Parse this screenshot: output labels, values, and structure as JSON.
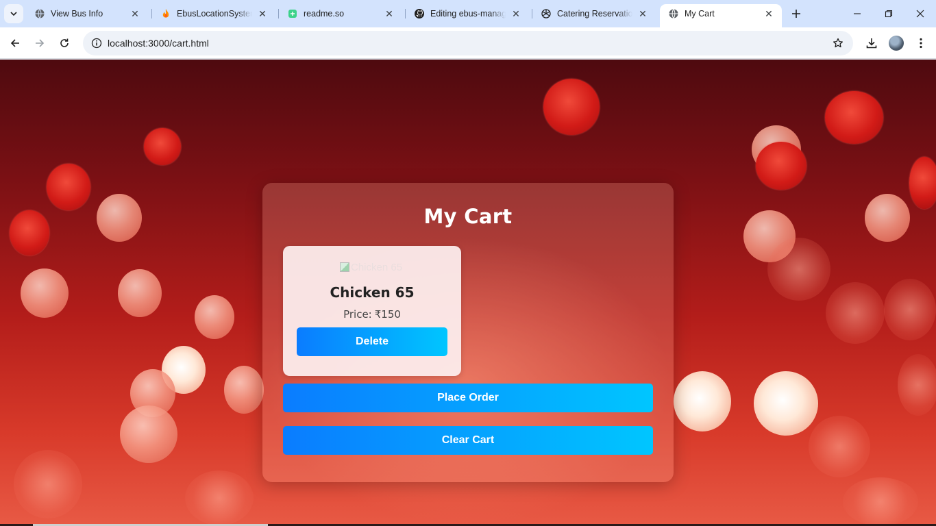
{
  "browser": {
    "tabs": [
      {
        "title": "View Bus Info",
        "icon": "globe-icon"
      },
      {
        "title": "EbusLocationSystem -",
        "icon": "firebase-icon"
      },
      {
        "title": "readme.so",
        "icon": "readme-icon"
      },
      {
        "title": "Editing ebus-manage",
        "icon": "github-icon"
      },
      {
        "title": "Catering Reservation",
        "icon": "openai-icon"
      },
      {
        "title": "My Cart",
        "icon": "globe-icon",
        "active": true
      }
    ],
    "url": "localhost:3000/cart.html"
  },
  "page": {
    "title": "My Cart",
    "items": [
      {
        "image_alt": "Chicken 65",
        "name": "Chicken 65",
        "price_label": "Price:",
        "price": "₹150",
        "delete_label": "Delete"
      }
    ],
    "place_order_label": "Place Order",
    "clear_cart_label": "Clear Cart"
  },
  "colors": {
    "button_gradient_start": "#0a7cff",
    "button_gradient_end": "#00c6ff",
    "tabstrip_bg": "#d3e3fd"
  }
}
